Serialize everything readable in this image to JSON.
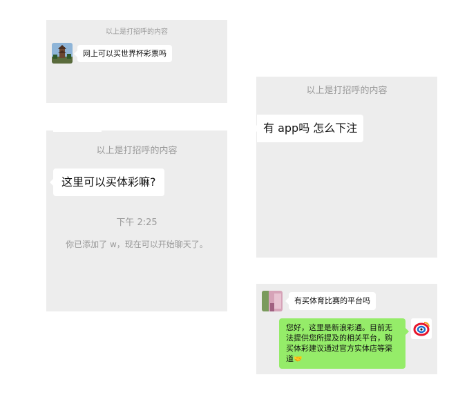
{
  "panel1": {
    "system_text": "以上是打招呼的内容",
    "message": "网上可以买世界杯彩票吗",
    "avatar_icon": "tower-photo-avatar"
  },
  "panel2": {
    "system_text": "以上是打招呼的内容",
    "message": "这里可以买体彩嘛?",
    "time": "下午 2:25",
    "added_notice": "你已添加了 w，现在可以开始聊天了。"
  },
  "panel3": {
    "system_text": "以上是打招呼的内容",
    "message": "有 app吗 怎么下注"
  },
  "panel4": {
    "message": "有买体育比赛的平台吗",
    "reply": "您好，这里是新浪彩通。目前无法提供您所提及的相关平台，购买体彩建议通过官方实体店等渠道",
    "reply_emoji": "🤝",
    "user_avatar_icon": "pink-photo-avatar",
    "brand_avatar_icon": "sina-logo-icon"
  },
  "colors": {
    "panel_bg": "#ededed",
    "system_text": "#9a9a9a",
    "bubble_white": "#ffffff",
    "bubble_green": "#95ec69"
  }
}
